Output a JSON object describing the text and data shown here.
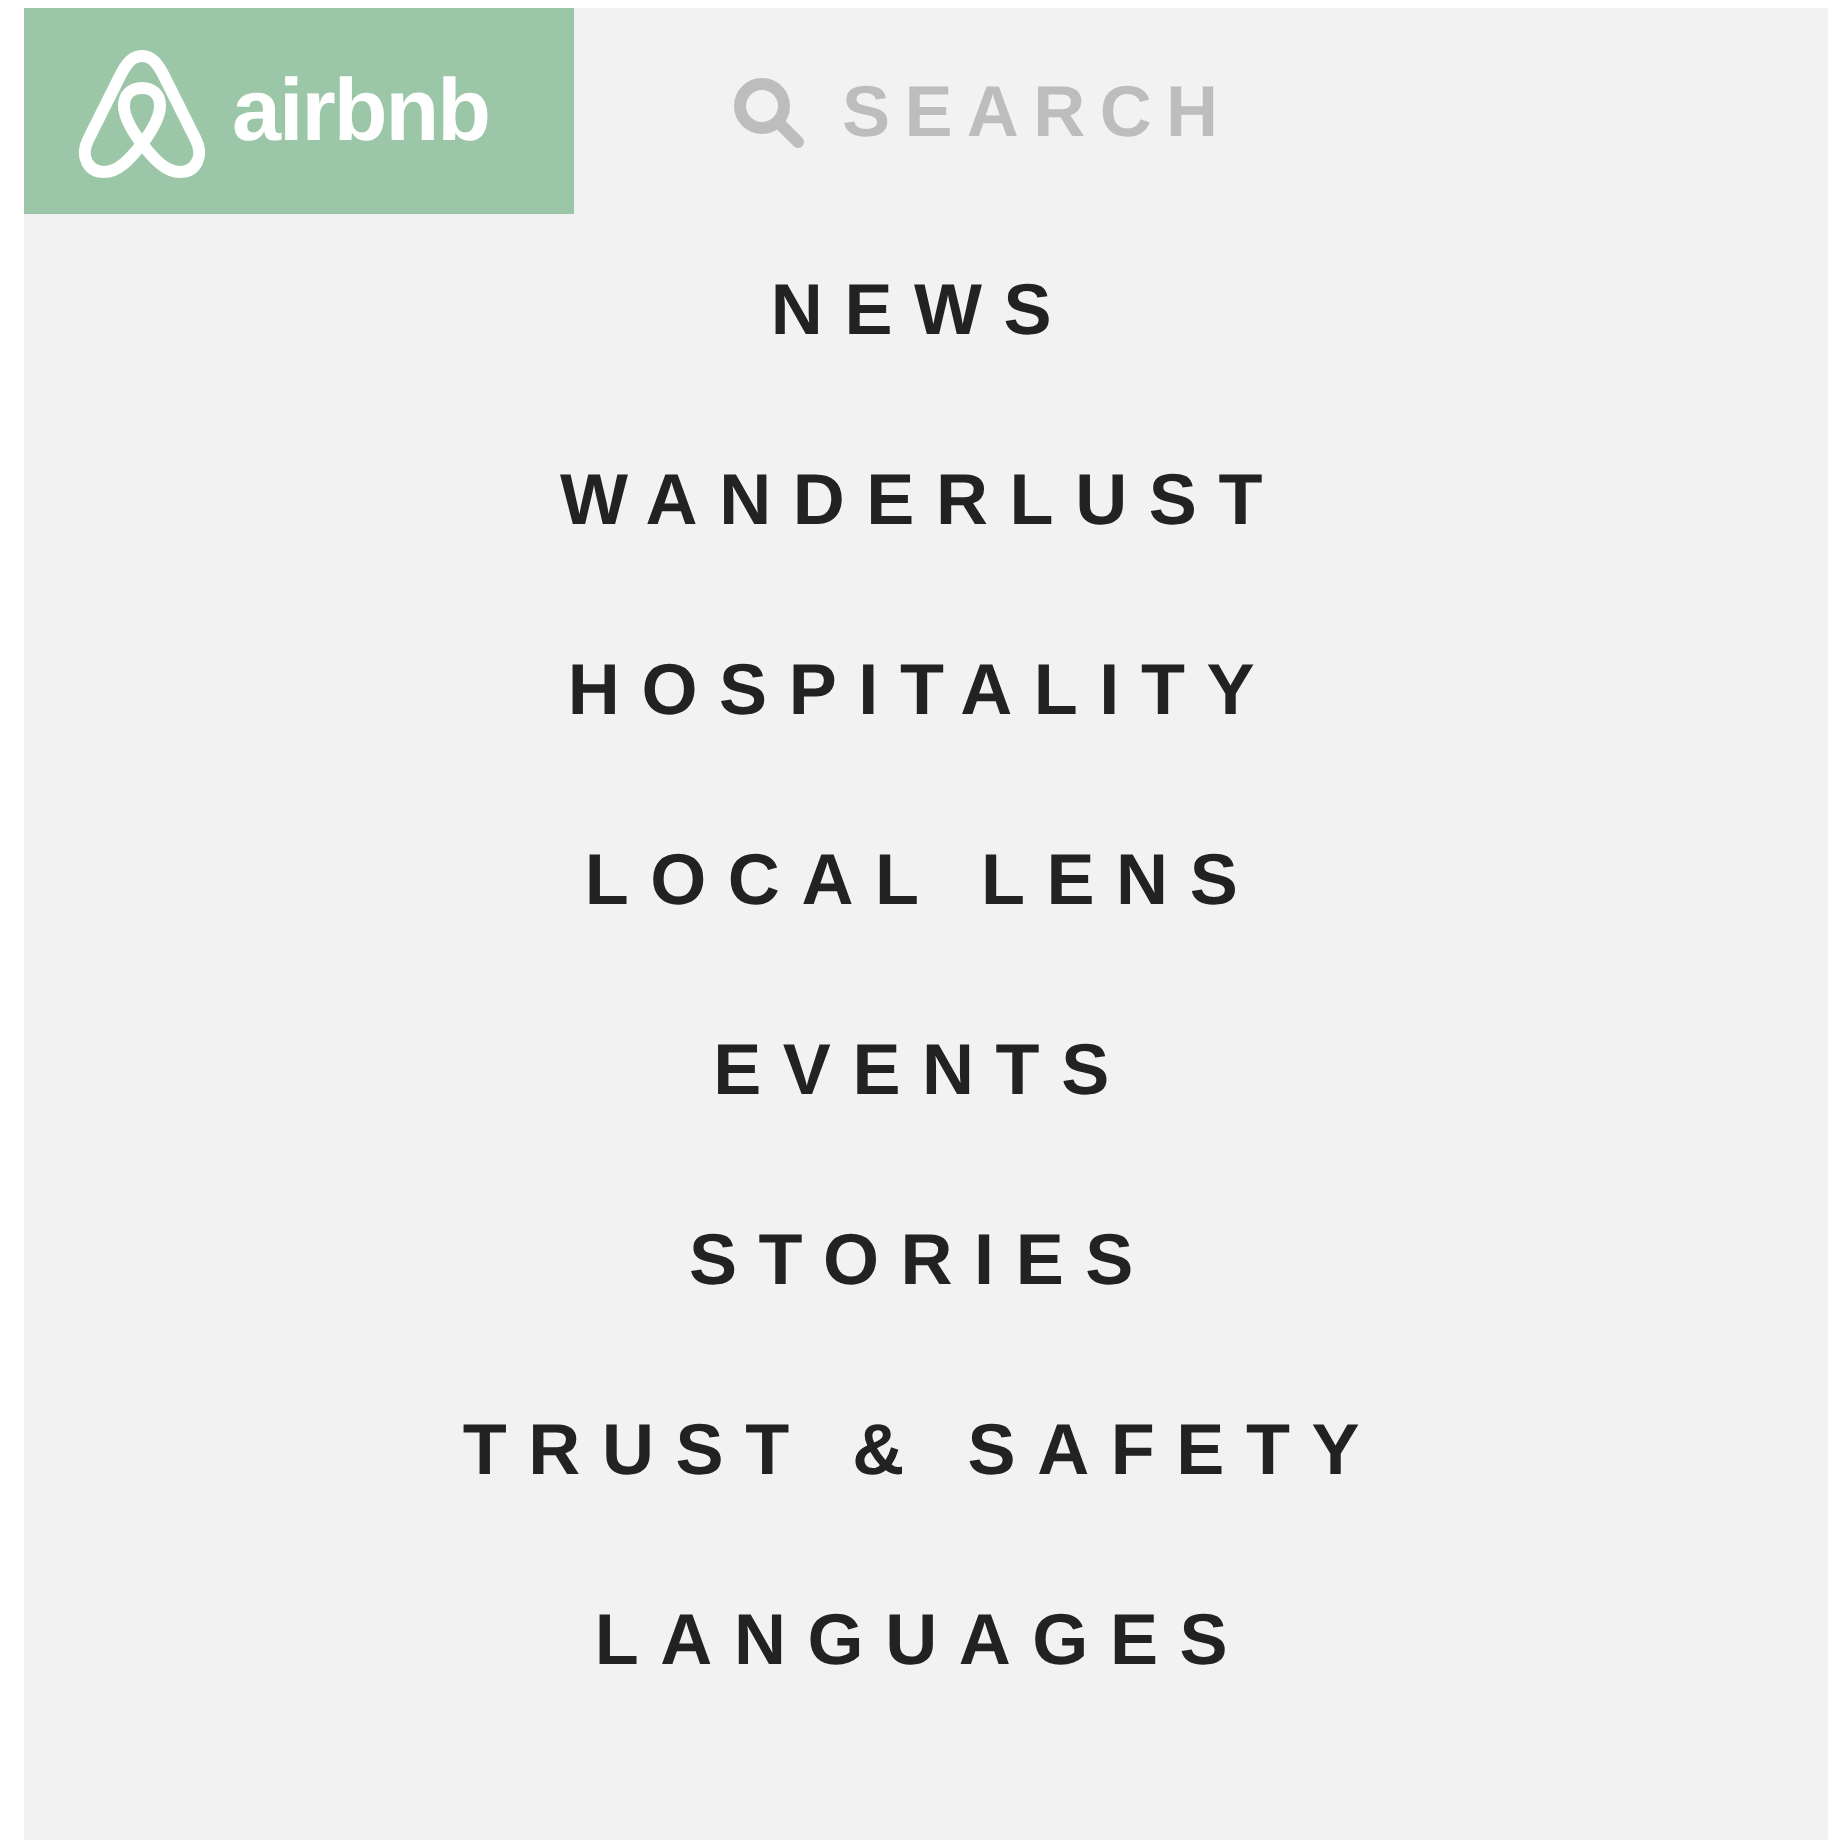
{
  "logo": {
    "wordmark": "airbnb"
  },
  "search": {
    "label": "SEARCH"
  },
  "menu": [
    {
      "label": "NEWS"
    },
    {
      "label": "WANDERLUST"
    },
    {
      "label": "HOSPITALITY"
    },
    {
      "label": "LOCAL LENS"
    },
    {
      "label": "EVENTS"
    },
    {
      "label": "STORIES"
    },
    {
      "label": "TRUST & SAFETY"
    },
    {
      "label": "LANGUAGES"
    }
  ]
}
